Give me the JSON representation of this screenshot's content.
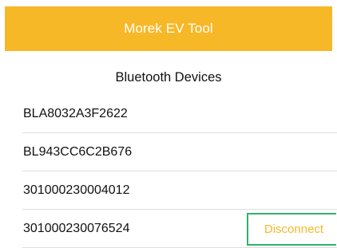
{
  "header": {
    "title": "Morek EV Tool"
  },
  "section": {
    "title": "Bluetooth Devices"
  },
  "devices": [
    {
      "name": "BLA8032A3F2622"
    },
    {
      "name": "BL943CC6C2B676"
    },
    {
      "name": "301000230004012"
    },
    {
      "name": "301000230076524",
      "action_label": "Disconnect"
    }
  ],
  "colors": {
    "accent": "#f7b827",
    "header_text": "#ffffff",
    "action_border": "#2fb36a",
    "divider": "#dddddd"
  }
}
